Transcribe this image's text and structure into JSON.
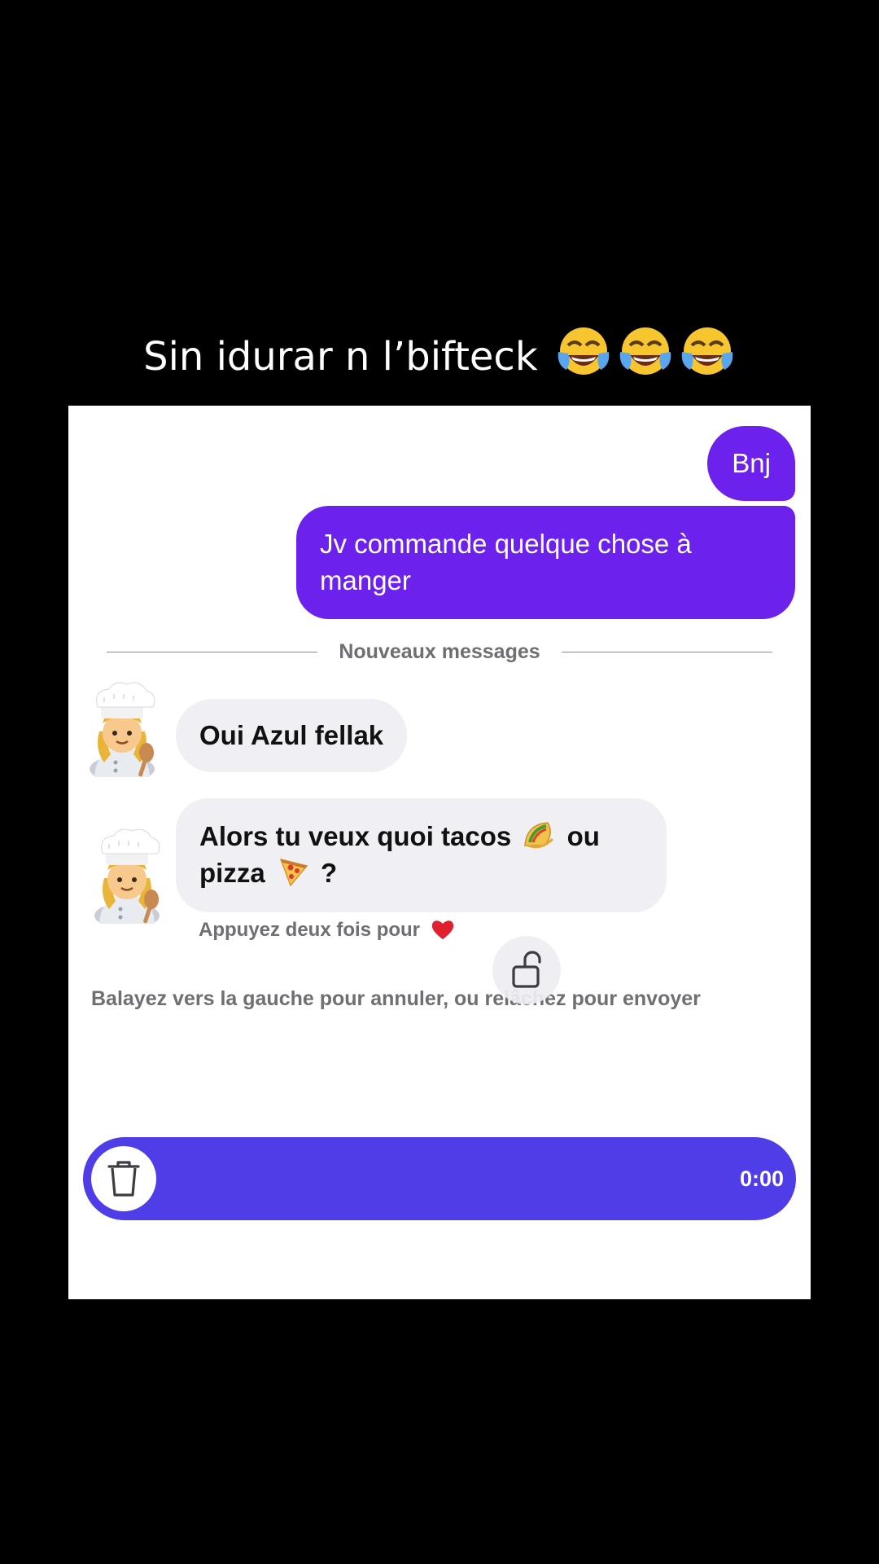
{
  "caption": {
    "text": "Sin idurar n l’bifteck",
    "emoji": [
      "face-with-tears-of-joy-icon",
      "face-with-tears-of-joy-icon",
      "face-with-tears-of-joy-icon"
    ]
  },
  "chat": {
    "outgoing": [
      {
        "text": "Bnj"
      },
      {
        "text": "Jv commande quelque chose à manger"
      }
    ],
    "divider_label": "Nouveaux messages",
    "incoming": [
      {
        "avatar": "cook-avatar-icon",
        "text": "Oui Azul fellak"
      },
      {
        "avatar": "cook-avatar-icon",
        "part1": "Alors tu veux quoi tacos",
        "part2": "ou pizza",
        "part3": "?"
      }
    ],
    "like_hint": "Appuyez deux fois pour",
    "swipe_hint": "Balayez vers la gauche pour annuler, ou relâchez pour envoyer"
  },
  "recorder": {
    "timer": "0:00",
    "lock_icon": "unlock-icon",
    "delete_icon": "trash-icon"
  },
  "colors": {
    "outgoing_bubble": "#6c22ec",
    "incoming_bubble": "#efeff4",
    "record_bar": "#4f3de8",
    "heart": "#e0202f"
  }
}
